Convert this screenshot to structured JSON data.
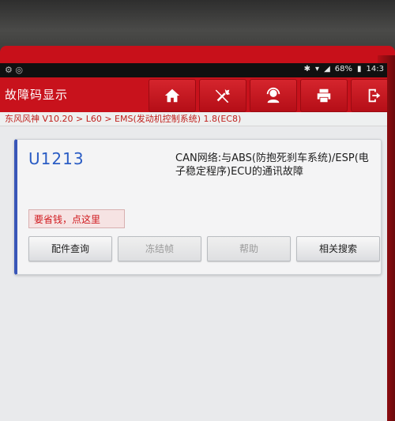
{
  "status": {
    "battery": "68%",
    "time": "14:3"
  },
  "header": {
    "title": "故障码显示"
  },
  "toolbar": {
    "home_icon": "home-icon",
    "clear_icon": "clear-diagnostics-icon",
    "support_icon": "support-agent-icon",
    "print_icon": "printer-icon",
    "exit_icon": "exit-icon"
  },
  "breadcrumb": "东风风神 V10.20 > L60 > EMS(发动机控制系统) 1.8(EC8)",
  "fault": {
    "code": "U1213",
    "description": "CAN网络:与ABS(防抱死刹车系统)/ESP(电子稳定程序)ECU的通讯故障"
  },
  "promo_label": "要省钱，点这里",
  "actions": {
    "parts": "配件查询",
    "freeze": "冻结帧",
    "help": "帮助",
    "search": "相关搜索"
  },
  "colors": {
    "brand_red": "#c8121c",
    "code_blue": "#2a5cc4"
  }
}
